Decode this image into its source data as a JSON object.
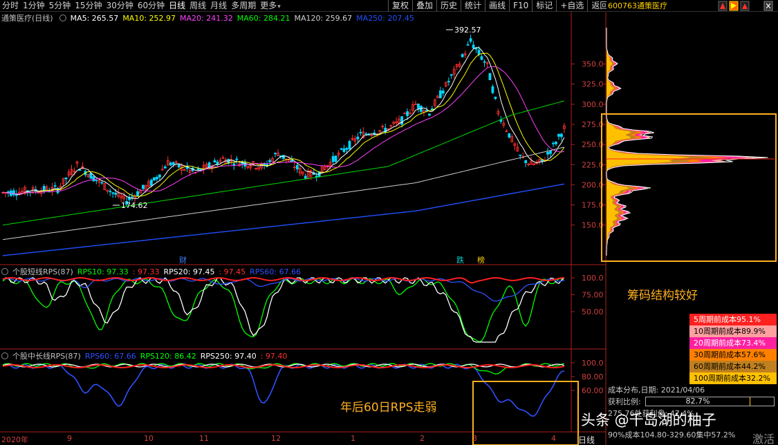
{
  "toolbar": {
    "periods": [
      "分时",
      "1分钟",
      "5分钟",
      "15分钟",
      "30分钟",
      "60分钟",
      "日线",
      "周线",
      "月线",
      "多周期",
      "更多"
    ],
    "active_period": "日线",
    "right": [
      "复权",
      "叠加",
      "历史",
      "统计",
      "画线",
      "F10",
      "标记",
      "+自选",
      "返回"
    ]
  },
  "stock": {
    "code": "600763",
    "name": "通策医疗"
  },
  "main_panel": {
    "title": "通策医疗(日线)",
    "ma": [
      {
        "label": "MA5: 265.57",
        "color": "#ffffff"
      },
      {
        "label": "MA10: 252.97",
        "color": "#ffff00"
      },
      {
        "label": "MA20: 241.32",
        "color": "#ff40ff"
      },
      {
        "label": "MA60: 284.21",
        "color": "#00ff00"
      },
      {
        "label": "MA120: 259.67",
        "color": "#d0d0d0"
      },
      {
        "label": "MA250: 207.45",
        "color": "#2050ff"
      }
    ],
    "high_label": "392.57",
    "low_label": "174.62",
    "axis": [
      "350.0",
      "325.0",
      "300.0",
      "275.0",
      "250.0",
      "225.0",
      "200.0",
      "175.0",
      "150.0"
    ],
    "tags": [
      {
        "text": "财",
        "color": "#4080ff"
      },
      {
        "text": "跌",
        "color": "#00d0d0"
      },
      {
        "text": "榜",
        "color": "#ffd000"
      }
    ]
  },
  "rps_short": {
    "title": "个股短线RPS(87)",
    "items": [
      {
        "label": "RPS10: 97.33",
        "color": "#00ff00"
      },
      {
        "label": ": 97.33",
        "color": "#ff3030"
      },
      {
        "label": "RPS20: 97.45",
        "color": "#ffffff"
      },
      {
        "label": ": 97.45",
        "color": "#ff3030"
      },
      {
        "label": "RPS60: 67.66",
        "color": "#3050ff"
      }
    ],
    "axis": [
      "100.0",
      "75.00",
      "50.00"
    ]
  },
  "rps_long": {
    "title": "个股中长线RPS(87)",
    "items": [
      {
        "label": "RPS60: 67.66",
        "color": "#3050ff"
      },
      {
        "label": "RPS120: 86.42",
        "color": "#00ff00"
      },
      {
        "label": "RPS250: 97.40",
        "color": "#ffffff"
      },
      {
        "label": ": 97.40",
        "color": "#ff3030"
      }
    ],
    "axis": [
      "100.0",
      "80.00",
      "60.00"
    ]
  },
  "x_axis": [
    "2020年",
    "9",
    "10",
    "11",
    "12",
    "1",
    "2",
    "3",
    "4"
  ],
  "period_label": "日线",
  "annotations": {
    "chips": "筹码结构较好",
    "rps_weak": "年后60日RPS走弱"
  },
  "cost_legend": [
    {
      "label": "5周期前成本95.1%",
      "bg": "#ff2020",
      "fg": "#ffffff"
    },
    {
      "label": "10周期前成本89.9%",
      "bg": "#ffa0a0",
      "fg": "#000000"
    },
    {
      "label": "20周期前成本73.4%",
      "bg": "#ff20a0",
      "fg": "#ffffff"
    },
    {
      "label": "30周期前成本57.6%",
      "bg": "#ff8000",
      "fg": "#000000"
    },
    {
      "label": "60周期前成本44.2%",
      "bg": "#c08020",
      "fg": "#000000"
    },
    {
      "label": "100周期前成本32.2%",
      "bg": "#ffc000",
      "fg": "#000000"
    }
  ],
  "cost_info": {
    "date_line": "成本分布,日期: 2021/04/06",
    "profit_label": "获利比例:",
    "profit_value": "82.7%",
    "profit_ratio": 0.827,
    "avg_line": "275.76处获利盘: 47.4%",
    "range_line": "90%成本104.80-329.60集中57.2%"
  },
  "watermark": "头条 @千岛湖的柚子",
  "corner_text": "激活"
}
